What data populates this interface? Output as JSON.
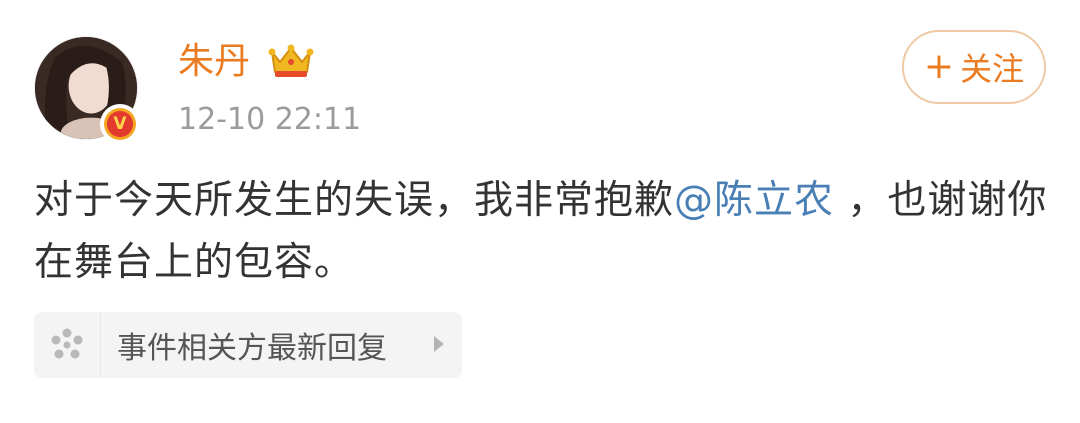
{
  "author": {
    "name": "朱丹",
    "avatar_icon": "user-avatar",
    "badge_icon": "crown-icon",
    "verified_icon": "verified-v-badge",
    "verified_letter": "V",
    "timestamp": "12-10 22:11"
  },
  "follow": {
    "plus": "+",
    "label": "关注"
  },
  "post": {
    "text_before": "对于今天所发生的失误，我非常抱歉",
    "mention": "@陈立农",
    "text_after": " ，也谢谢你在舞台上的包容。"
  },
  "event_link": {
    "icon": "event-cluster-icon",
    "label": "事件相关方最新回复"
  },
  "colors": {
    "name": "#ea7b20",
    "mention": "#4a7fb5",
    "text": "#333333",
    "timestamp": "#9b9b9b"
  }
}
